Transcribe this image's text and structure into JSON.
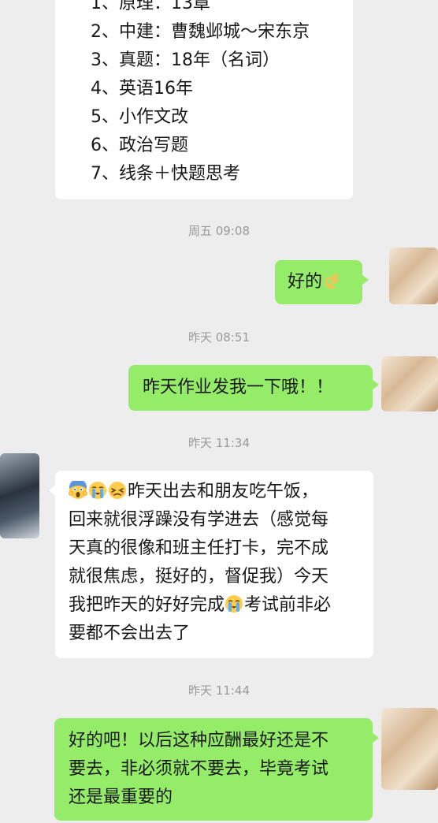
{
  "list_message": {
    "items": [
      "1、原理：13章",
      "2、中建：曹魏邺城～宋东京",
      "3、真题：18年（名词）",
      "4、英语16年",
      "5、小作文改",
      "6、政治写题",
      "7、线条＋快题思考"
    ]
  },
  "timestamps": {
    "t1": "周五 09:08",
    "t2": "昨天 08:51",
    "t3": "昨天 11:34",
    "t4": "昨天 11:44"
  },
  "msg_ok": {
    "text": "好的",
    "emoji": "ok-hand-emoji"
  },
  "msg_homework": "昨天作业发我一下哦！！",
  "msg_long": {
    "emojis": [
      "screaming-face-emoji",
      "loudly-crying-face-emoji",
      "persevering-face-emoji"
    ],
    "line1": "昨天出去和朋友吃午饭，",
    "line2": "回来就很浮躁没有学进去（感觉每",
    "line3": "天真的很像和班主任打卡，完不成",
    "line4": "就很焦虑，挺好的，督促我）今天",
    "line5_a": "我把昨天的好好完成",
    "line5_emoji": "loudly-crying-face-emoji",
    "line5_b": "考试前非必",
    "line6": "要都不会出去了"
  },
  "msg_reply": {
    "line1": "好的吧！以后这种应酬最好还是不",
    "line2": "要去，非必须就不要去，毕竟考试",
    "line3": "还是最重要的"
  },
  "colors": {
    "background": "#ededed",
    "incoming_bubble": "#ffffff",
    "outgoing_bubble": "#95ec69",
    "timestamp_text": "#9a9a9a"
  }
}
